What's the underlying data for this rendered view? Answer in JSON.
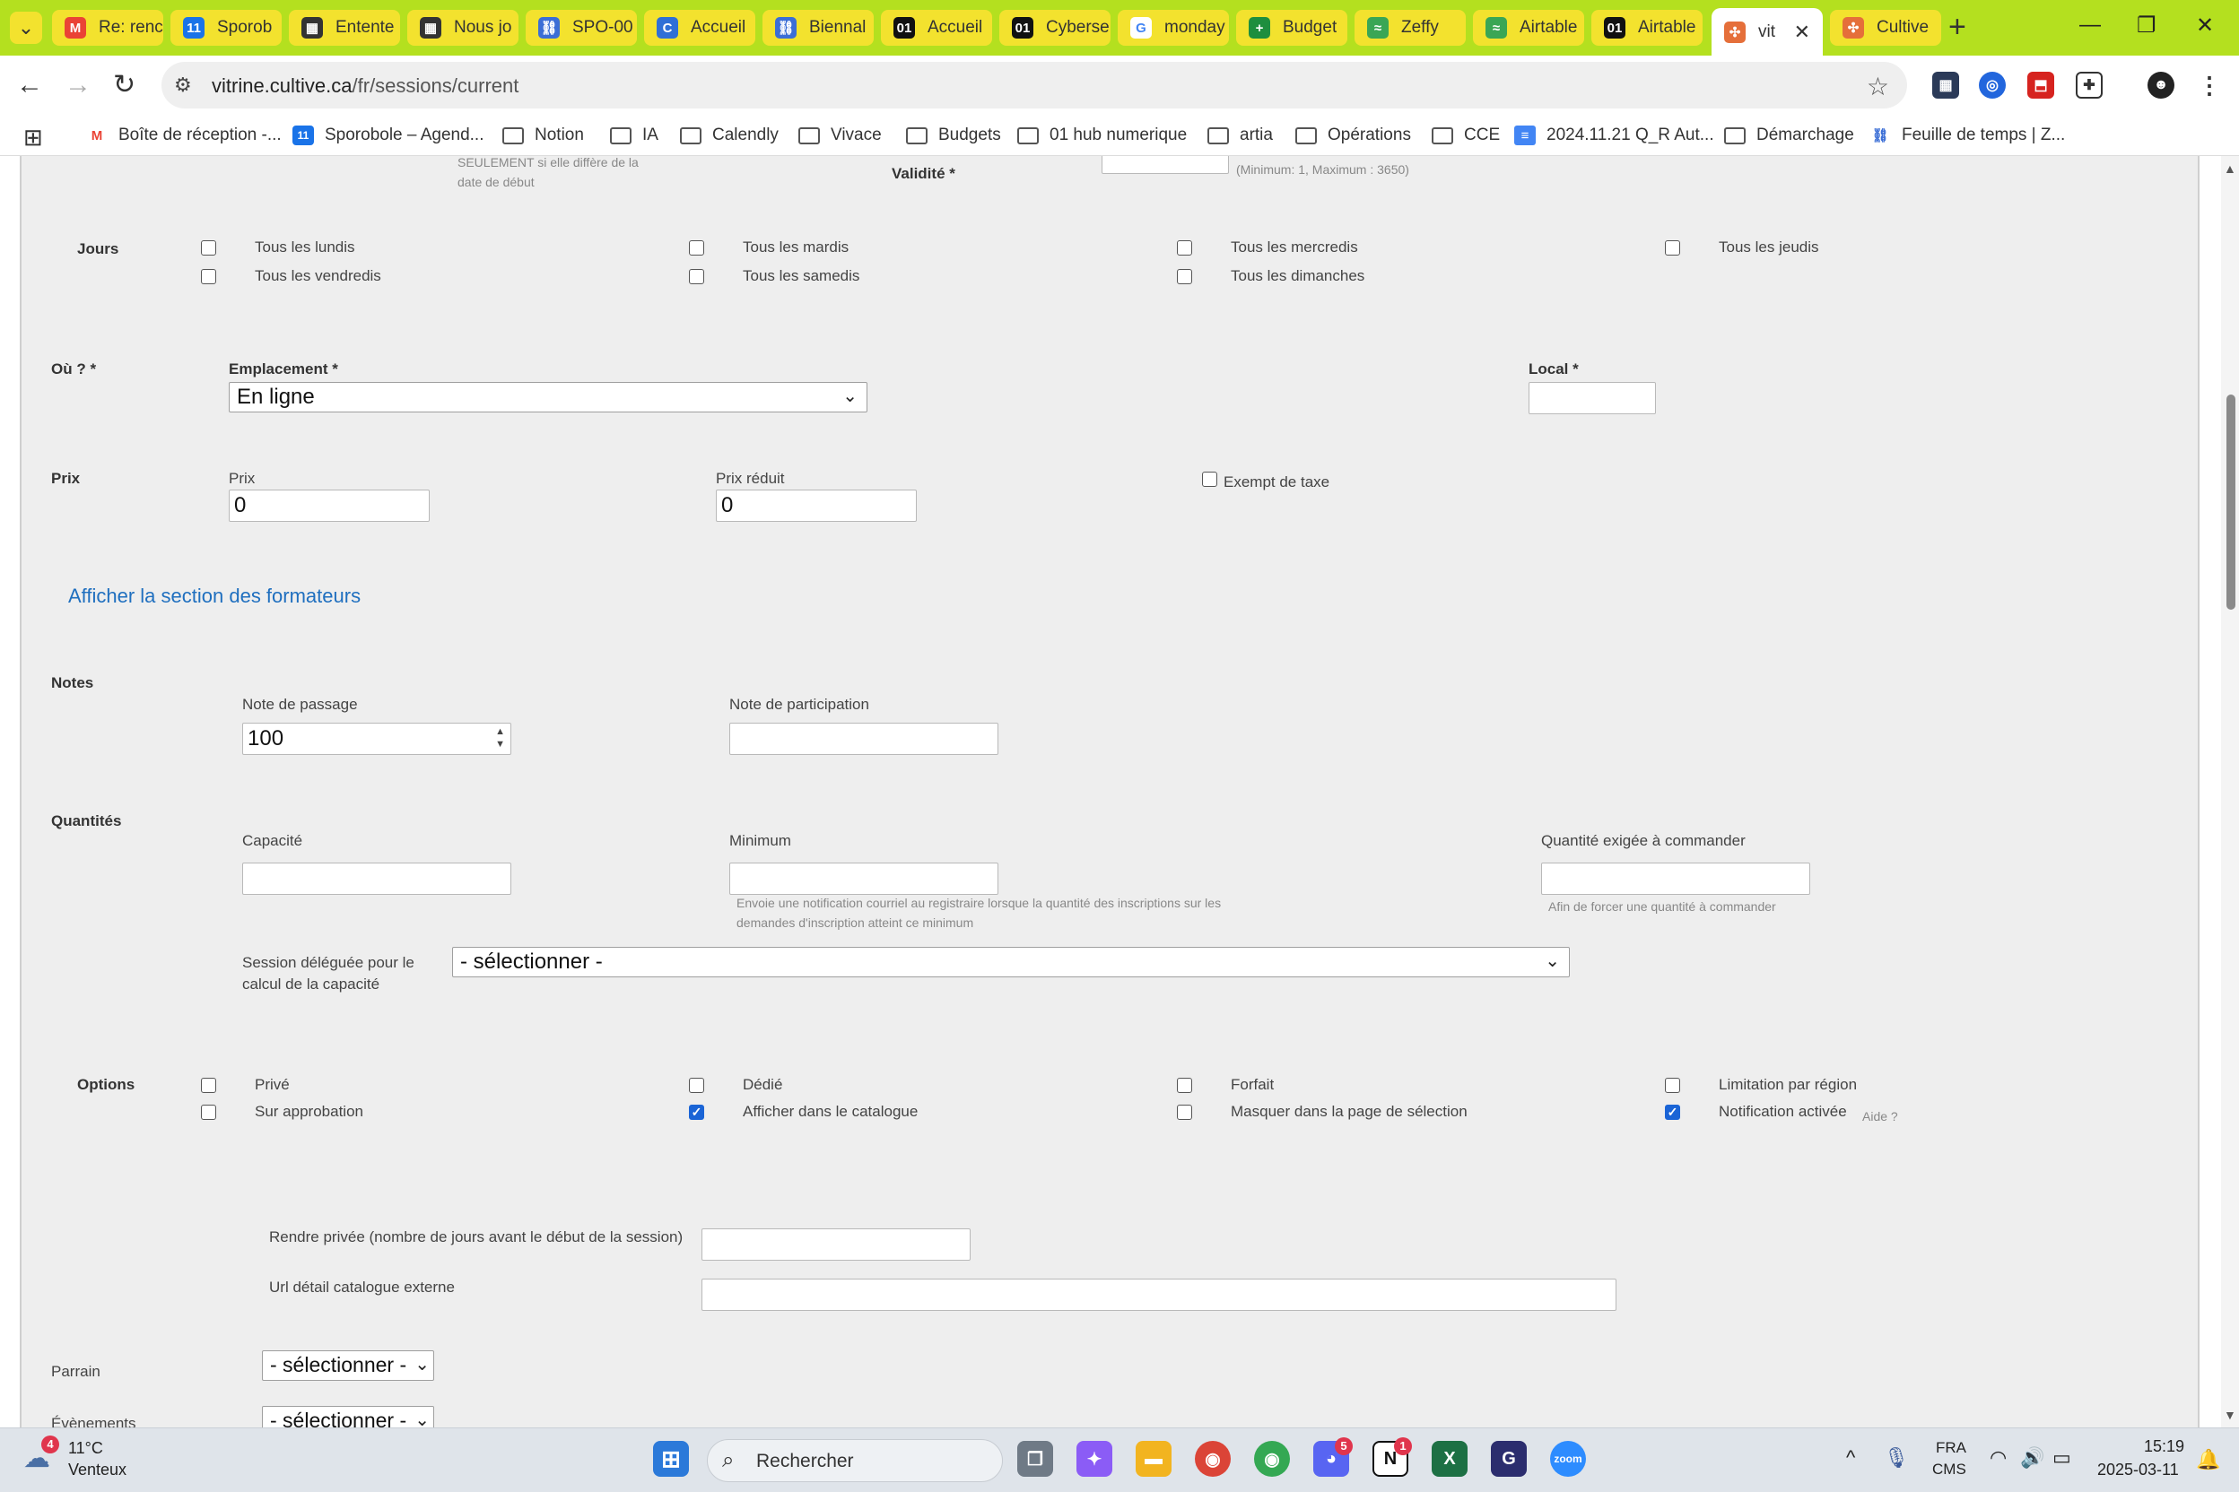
{
  "tabs": [
    {
      "label": "Re: renc",
      "icon": "gmail-icon",
      "color": "#ea4335",
      "glyph": "M"
    },
    {
      "label": "Sporob",
      "icon": "calendar-icon",
      "color": "#1a73e8",
      "glyph": "11"
    },
    {
      "label": "Entente",
      "icon": "film-icon",
      "color": "#333333",
      "glyph": "▦"
    },
    {
      "label": "Nous jo",
      "icon": "film-icon",
      "color": "#333333",
      "glyph": "▦"
    },
    {
      "label": "SPO-00",
      "icon": "link-icon",
      "color": "#3b6ed6",
      "glyph": "⛓"
    },
    {
      "label": "Accueil",
      "icon": "c-logo-icon",
      "color": "#2f6fd6",
      "glyph": "C"
    },
    {
      "label": "Biennal",
      "icon": "link-icon",
      "color": "#3b6ed6",
      "glyph": "⛓"
    },
    {
      "label": "Accueil",
      "icon": "o1-logo-icon",
      "color": "#111111",
      "glyph": "01"
    },
    {
      "label": "Cyberse",
      "icon": "o1-logo-icon",
      "color": "#111111",
      "glyph": "01"
    },
    {
      "label": "monday",
      "icon": "google-icon",
      "color": "#ffffff",
      "glyph": "G"
    },
    {
      "label": "Budget",
      "icon": "sheets-icon",
      "color": "#1e8e3e",
      "glyph": "+"
    },
    {
      "label": "Zeffy",
      "icon": "zeffy-icon",
      "color": "#3aa655",
      "glyph": "≈"
    },
    {
      "label": "Airtable",
      "icon": "zeffy-icon",
      "color": "#3aa655",
      "glyph": "≈"
    },
    {
      "label": "Airtable",
      "icon": "o1-logo-icon",
      "color": "#111111",
      "glyph": "01"
    },
    {
      "label": "vit",
      "icon": "cultive-icon",
      "color": "#e56f3a",
      "glyph": "✣",
      "active": true
    },
    {
      "label": "Cultive",
      "icon": "cultive-icon",
      "color": "#e56f3a",
      "glyph": "✣"
    }
  ],
  "address": {
    "host": "vitrine.cultive.ca",
    "path": "/fr/sessions/current"
  },
  "bookmarks": [
    {
      "label": "Boîte de réception -...",
      "icon": "gmail-icon"
    },
    {
      "label": "Sporobole – Agend...",
      "icon": "calendar-icon"
    },
    {
      "label": "Notion",
      "icon": "folder-icon"
    },
    {
      "label": "IA",
      "icon": "folder-icon"
    },
    {
      "label": "Calendly",
      "icon": "folder-icon"
    },
    {
      "label": "Vivace",
      "icon": "folder-icon"
    },
    {
      "label": "Budgets",
      "icon": "folder-icon"
    },
    {
      "label": "01 hub numerique",
      "icon": "folder-icon"
    },
    {
      "label": "artia",
      "icon": "folder-icon"
    },
    {
      "label": "Opérations",
      "icon": "folder-icon"
    },
    {
      "label": "CCE",
      "icon": "folder-icon"
    },
    {
      "label": "2024.11.21 Q_R Aut...",
      "icon": "docs-icon"
    },
    {
      "label": "Démarchage",
      "icon": "folder-icon"
    },
    {
      "label": "Feuille de temps | Z...",
      "icon": "link-icon"
    }
  ],
  "form": {
    "top_hint": "SEULEMENT si elle diffère de la\ndate de début",
    "validite_label": "Validité *",
    "validite_hint": "(Minimum: 1, Maximum : 3650)",
    "jours_label": "Jours",
    "jours": [
      {
        "label": "Tous les lundis",
        "checked": false
      },
      {
        "label": "Tous les mardis",
        "checked": false
      },
      {
        "label": "Tous les mercredis",
        "checked": false
      },
      {
        "label": "Tous les jeudis",
        "checked": false
      },
      {
        "label": "Tous les vendredis",
        "checked": false
      },
      {
        "label": "Tous les samedis",
        "checked": false
      },
      {
        "label": "Tous les dimanches",
        "checked": false
      }
    ],
    "ou_label": "Où ? *",
    "emplacement_label": "Emplacement *",
    "emplacement_value": "En ligne",
    "local_label": "Local *",
    "local_value": "",
    "prix_section": "Prix",
    "prix_label": "Prix",
    "prix_value": "0",
    "prix_reduit_label": "Prix réduit",
    "prix_reduit_value": "0",
    "exempt_label": "Exempt de taxe",
    "exempt_checked": false,
    "formateurs_link": "Afficher la section des formateurs",
    "notes_section": "Notes",
    "note_passage_label": "Note de passage",
    "note_passage_value": "100",
    "note_participation_label": "Note de participation",
    "note_participation_value": "",
    "quantites_section": "Quantités",
    "capacite_label": "Capacité",
    "minimum_label": "Minimum",
    "minimum_hint": "Envoie une notification courriel au registraire lorsque la quantité des inscriptions sur les\ndemandes d'inscription atteint ce minimum",
    "qte_exigee_label": "Quantité exigée à commander",
    "qte_exigee_hint": "Afin de forcer une quantité à commander",
    "session_deleguee_label": "Session déléguée pour le\ncalcul de la capacité",
    "session_deleguee_value": "- sélectionner -",
    "options_section": "Options",
    "options": [
      {
        "label": "Privé",
        "checked": false
      },
      {
        "label": "Dédié",
        "checked": false
      },
      {
        "label": "Forfait",
        "checked": false
      },
      {
        "label": "Limitation par région",
        "checked": false
      },
      {
        "label": "Sur approbation",
        "checked": false
      },
      {
        "label": "Afficher dans le catalogue",
        "checked": true
      },
      {
        "label": "Masquer dans la page de sélection",
        "checked": false
      },
      {
        "label": "Notification activée",
        "checked": true
      }
    ],
    "aide_label": "Aide ?",
    "rendre_privee_label": "Rendre privée (nombre de jours avant le début de la session)",
    "url_externe_label": "Url détail catalogue externe",
    "parrain_label": "Parrain",
    "parrain_value": "- sélectionner -",
    "evenements_label": "Évènements",
    "evenements_value": "- sélectionner -"
  },
  "taskbar": {
    "weather_temp": "11°C",
    "weather_desc": "Venteux",
    "weather_badge": "4",
    "search_placeholder": "Rechercher",
    "lang": "FRA",
    "lang_sub": "CMS",
    "time": "15:19",
    "date": "2025-03-11",
    "discord_badge": "5",
    "notion_badge": "1"
  },
  "colors": {
    "chrome_frame": "#b4e01f",
    "tab_bg": "#f3e22e",
    "link": "#1f6fbf",
    "checkbox_on": "#1a64d6"
  }
}
